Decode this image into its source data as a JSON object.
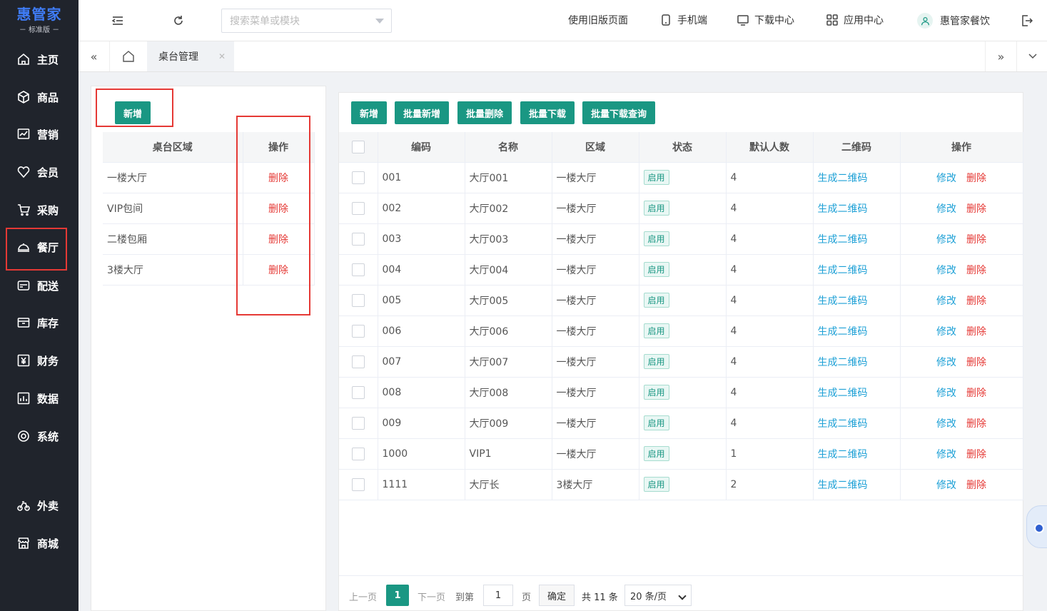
{
  "app": {
    "brand": "惠管家",
    "edition": "－ 标准版 －"
  },
  "sidebar": {
    "items": [
      {
        "label": "主页",
        "icon": "home-icon"
      },
      {
        "label": "商品",
        "icon": "box-icon"
      },
      {
        "label": "营销",
        "icon": "chart-icon"
      },
      {
        "label": "会员",
        "icon": "heart-icon"
      },
      {
        "label": "采购",
        "icon": "cart-icon"
      },
      {
        "label": "餐厅",
        "icon": "cloche-icon"
      },
      {
        "label": "配送",
        "icon": "truck-icon"
      },
      {
        "label": "库存",
        "icon": "inventory-icon"
      },
      {
        "label": "财务",
        "icon": "yen-icon"
      },
      {
        "label": "数据",
        "icon": "bar-chart-icon"
      },
      {
        "label": "系统",
        "icon": "settings-icon"
      },
      {
        "label": "外卖",
        "icon": "bike-icon"
      },
      {
        "label": "商城",
        "icon": "store-icon"
      }
    ]
  },
  "topbar": {
    "search_placeholder": "搜索菜单或模块",
    "old_page": "使用旧版页面",
    "mobile": "手机端",
    "download": "下载中心",
    "apps": "应用中心",
    "user": "惠管家餐饮"
  },
  "tabs": {
    "active": "桌台管理"
  },
  "left_panel": {
    "add_label": "新增",
    "headers": {
      "area": "桌台区域",
      "op": "操作"
    },
    "rows": [
      {
        "area": "一楼大厅",
        "op": "删除"
      },
      {
        "area": "VIP包间",
        "op": "删除"
      },
      {
        "area": "二楼包厢",
        "op": "删除"
      },
      {
        "area": "3楼大厅",
        "op": "删除"
      }
    ]
  },
  "right_panel": {
    "buttons": {
      "add": "新增",
      "batch_add": "批量新增",
      "batch_delete": "批量删除",
      "batch_download": "批量下载",
      "batch_download_query": "批量下载查询"
    },
    "headers": {
      "code": "编码",
      "name": "名称",
      "area": "区域",
      "status": "状态",
      "people": "默认人数",
      "qrcode": "二维码",
      "op": "操作"
    },
    "rows": [
      {
        "code": "001",
        "name": "大厅001",
        "area": "一楼大厅",
        "status": "启用",
        "people": "4",
        "qr": "生成二维码",
        "edit": "修改",
        "del": "删除"
      },
      {
        "code": "002",
        "name": "大厅002",
        "area": "一楼大厅",
        "status": "启用",
        "people": "4",
        "qr": "生成二维码",
        "edit": "修改",
        "del": "删除"
      },
      {
        "code": "003",
        "name": "大厅003",
        "area": "一楼大厅",
        "status": "启用",
        "people": "4",
        "qr": "生成二维码",
        "edit": "修改",
        "del": "删除"
      },
      {
        "code": "004",
        "name": "大厅004",
        "area": "一楼大厅",
        "status": "启用",
        "people": "4",
        "qr": "生成二维码",
        "edit": "修改",
        "del": "删除"
      },
      {
        "code": "005",
        "name": "大厅005",
        "area": "一楼大厅",
        "status": "启用",
        "people": "4",
        "qr": "生成二维码",
        "edit": "修改",
        "del": "删除"
      },
      {
        "code": "006",
        "name": "大厅006",
        "area": "一楼大厅",
        "status": "启用",
        "people": "4",
        "qr": "生成二维码",
        "edit": "修改",
        "del": "删除"
      },
      {
        "code": "007",
        "name": "大厅007",
        "area": "一楼大厅",
        "status": "启用",
        "people": "4",
        "qr": "生成二维码",
        "edit": "修改",
        "del": "删除"
      },
      {
        "code": "008",
        "name": "大厅008",
        "area": "一楼大厅",
        "status": "启用",
        "people": "4",
        "qr": "生成二维码",
        "edit": "修改",
        "del": "删除"
      },
      {
        "code": "009",
        "name": "大厅009",
        "area": "一楼大厅",
        "status": "启用",
        "people": "4",
        "qr": "生成二维码",
        "edit": "修改",
        "del": "删除"
      },
      {
        "code": "1000",
        "name": "VIP1",
        "area": "一楼大厅",
        "status": "启用",
        "people": "1",
        "qr": "生成二维码",
        "edit": "修改",
        "del": "删除"
      },
      {
        "code": "1111",
        "name": "大厅长",
        "area": "3楼大厅",
        "status": "启用",
        "people": "2",
        "qr": "生成二维码",
        "edit": "修改",
        "del": "删除"
      }
    ]
  },
  "pager": {
    "prev": "上一页",
    "page": "1",
    "next": "下一页",
    "goto": "到第",
    "input": "1",
    "unit": "页",
    "confirm": "确定",
    "total": "共 11 条",
    "per_page": "20 条/页"
  },
  "colors": {
    "accent": "#1a9783",
    "sidebar_bg": "#20242c",
    "danger": "#e53935",
    "link": "#1da0d6"
  }
}
